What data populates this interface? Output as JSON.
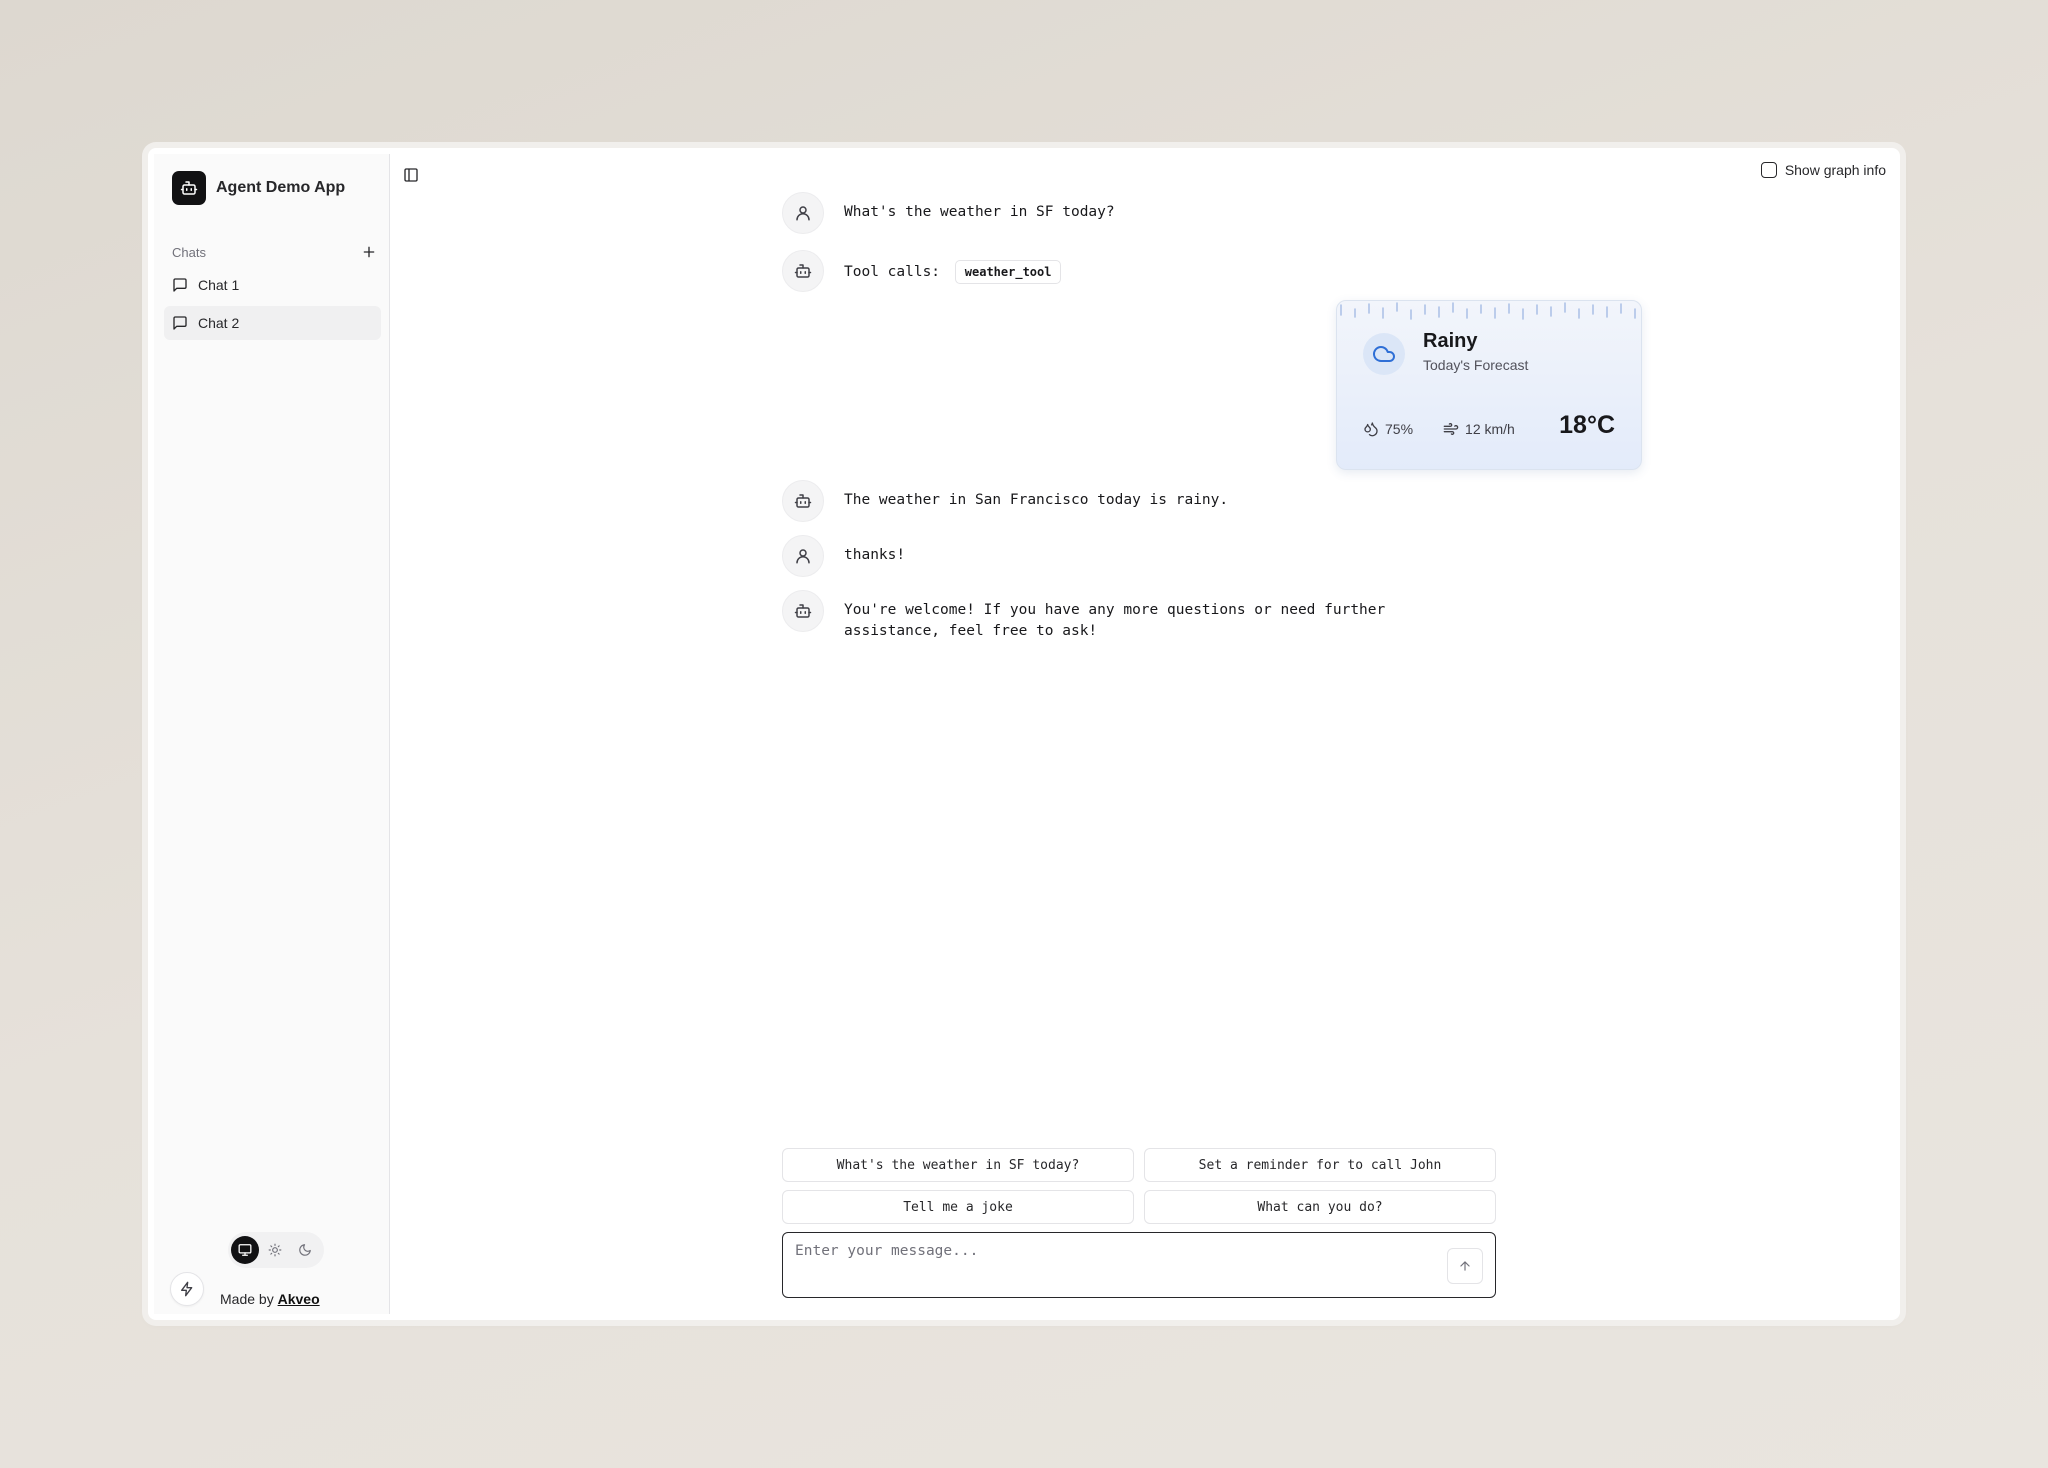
{
  "app": {
    "title": "Agent Demo App"
  },
  "sidebar": {
    "chats_label": "Chats",
    "items": [
      {
        "label": "Chat 1"
      },
      {
        "label": "Chat 2",
        "active": true
      }
    ],
    "made_by_prefix": "Made by",
    "made_by_link": "Akveo",
    "theme_options": [
      "system",
      "light",
      "dark"
    ],
    "theme_selected": "system"
  },
  "header": {
    "graph_info_label": "Show graph info",
    "graph_info_checked": false
  },
  "messages": [
    {
      "role": "user",
      "text": "What's the weather in SF today?"
    },
    {
      "role": "assistant",
      "text": "Tool calls:",
      "tool": "weather_tool"
    },
    {
      "role": "assistant",
      "text": "The weather in San Francisco today is rainy."
    },
    {
      "role": "user",
      "text": "thanks!"
    },
    {
      "role": "assistant",
      "text": "You're welcome! If you have any more questions or need further assistance, feel free to ask!"
    }
  ],
  "weather": {
    "condition": "Rainy",
    "subtitle": "Today's Forecast",
    "humidity": "75%",
    "wind": "12 km/h",
    "temperature": "18°C",
    "accent_color": "#2f6fd6"
  },
  "suggestions": [
    "What's the weather in SF today?",
    "Set a reminder for to call John",
    "Tell me a joke",
    "What can you do?"
  ],
  "composer": {
    "placeholder": "Enter your message...",
    "value": ""
  }
}
